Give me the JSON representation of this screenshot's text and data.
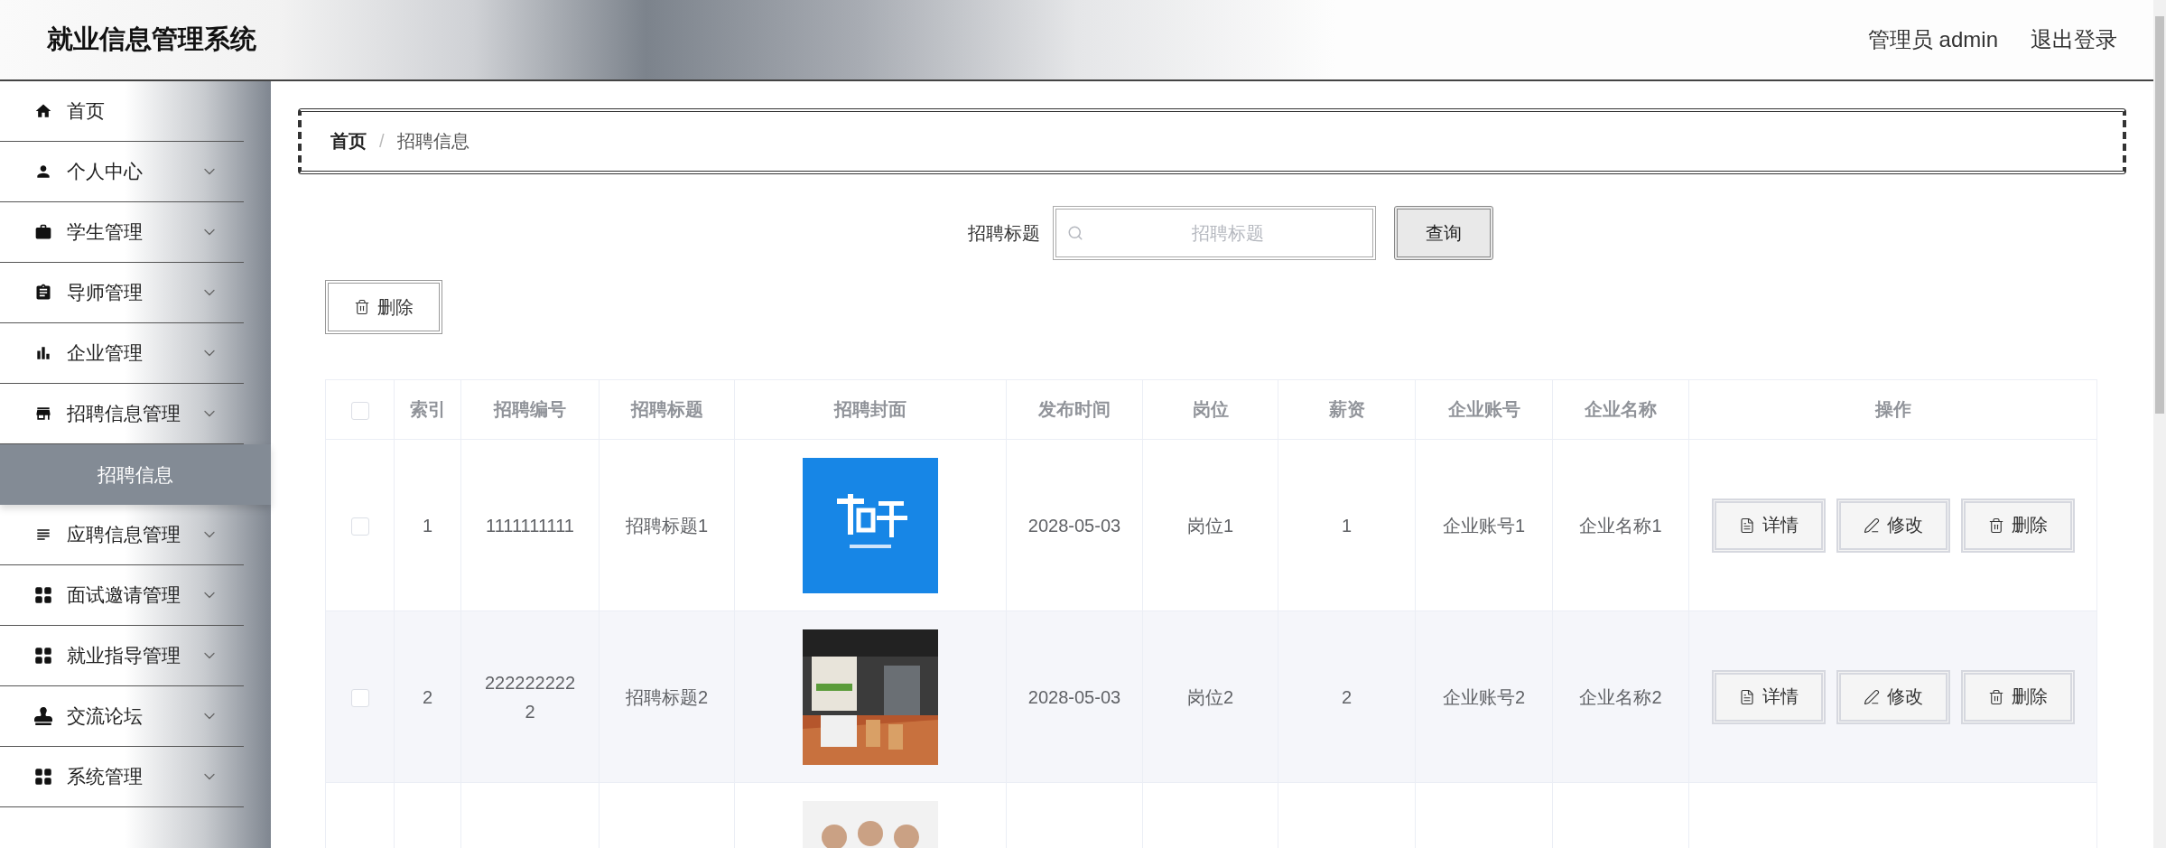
{
  "header": {
    "title": "就业信息管理系统",
    "user": "管理员 admin",
    "logout": "退出登录"
  },
  "sidebar": {
    "items": [
      {
        "label": "首页",
        "has_submenu": false
      },
      {
        "label": "个人中心",
        "has_submenu": true
      },
      {
        "label": "学生管理",
        "has_submenu": true
      },
      {
        "label": "导师管理",
        "has_submenu": true
      },
      {
        "label": "企业管理",
        "has_submenu": true
      },
      {
        "label": "招聘信息管理",
        "has_submenu": true,
        "expanded": true,
        "children": [
          {
            "label": "招聘信息",
            "selected": true
          }
        ]
      },
      {
        "label": "应聘信息管理",
        "has_submenu": true
      },
      {
        "label": "面试邀请管理",
        "has_submenu": true
      },
      {
        "label": "就业指导管理",
        "has_submenu": true
      },
      {
        "label": "交流论坛",
        "has_submenu": true
      },
      {
        "label": "系统管理",
        "has_submenu": true
      }
    ]
  },
  "breadcrumb": {
    "items": [
      "首页",
      "招聘信息"
    ],
    "separator": "/"
  },
  "search": {
    "label": "招聘标题",
    "placeholder": "招聘标题",
    "button": "查询"
  },
  "toolbar": {
    "delete": "删除"
  },
  "table": {
    "select_all": {
      "checked": false
    },
    "columns": [
      "索引",
      "招聘编号",
      "招聘标题",
      "招聘封面",
      "发布时间",
      "岗位",
      "薪资",
      "企业账号",
      "企业名称",
      "操作"
    ],
    "rows": [
      {
        "checked": false,
        "cells": [
          "1",
          "1111111111",
          "招聘标题1",
          "2028-05-03",
          "岗位1",
          "1",
          "企业账号1",
          "企业名称1"
        ],
        "cover": {
          "kind": "picture"
        },
        "actions": [
          {
            "kind": "detail",
            "label": "详情"
          },
          {
            "kind": "edit",
            "label": "修改"
          },
          {
            "kind": "delete",
            "label": "删除"
          }
        ]
      },
      {
        "checked": false,
        "cells": [
          "2",
          "2222222222",
          "招聘标题2",
          "2028-05-03",
          "岗位2",
          "2",
          "企业账号2",
          "企业名称2"
        ],
        "cover": {
          "kind": "picture"
        },
        "actions": [
          {
            "kind": "detail",
            "label": "详情"
          },
          {
            "kind": "edit",
            "label": "修改"
          },
          {
            "kind": "delete",
            "label": "删除"
          }
        ]
      },
      {
        "cover": {
          "kind": "picture"
        }
      }
    ]
  }
}
